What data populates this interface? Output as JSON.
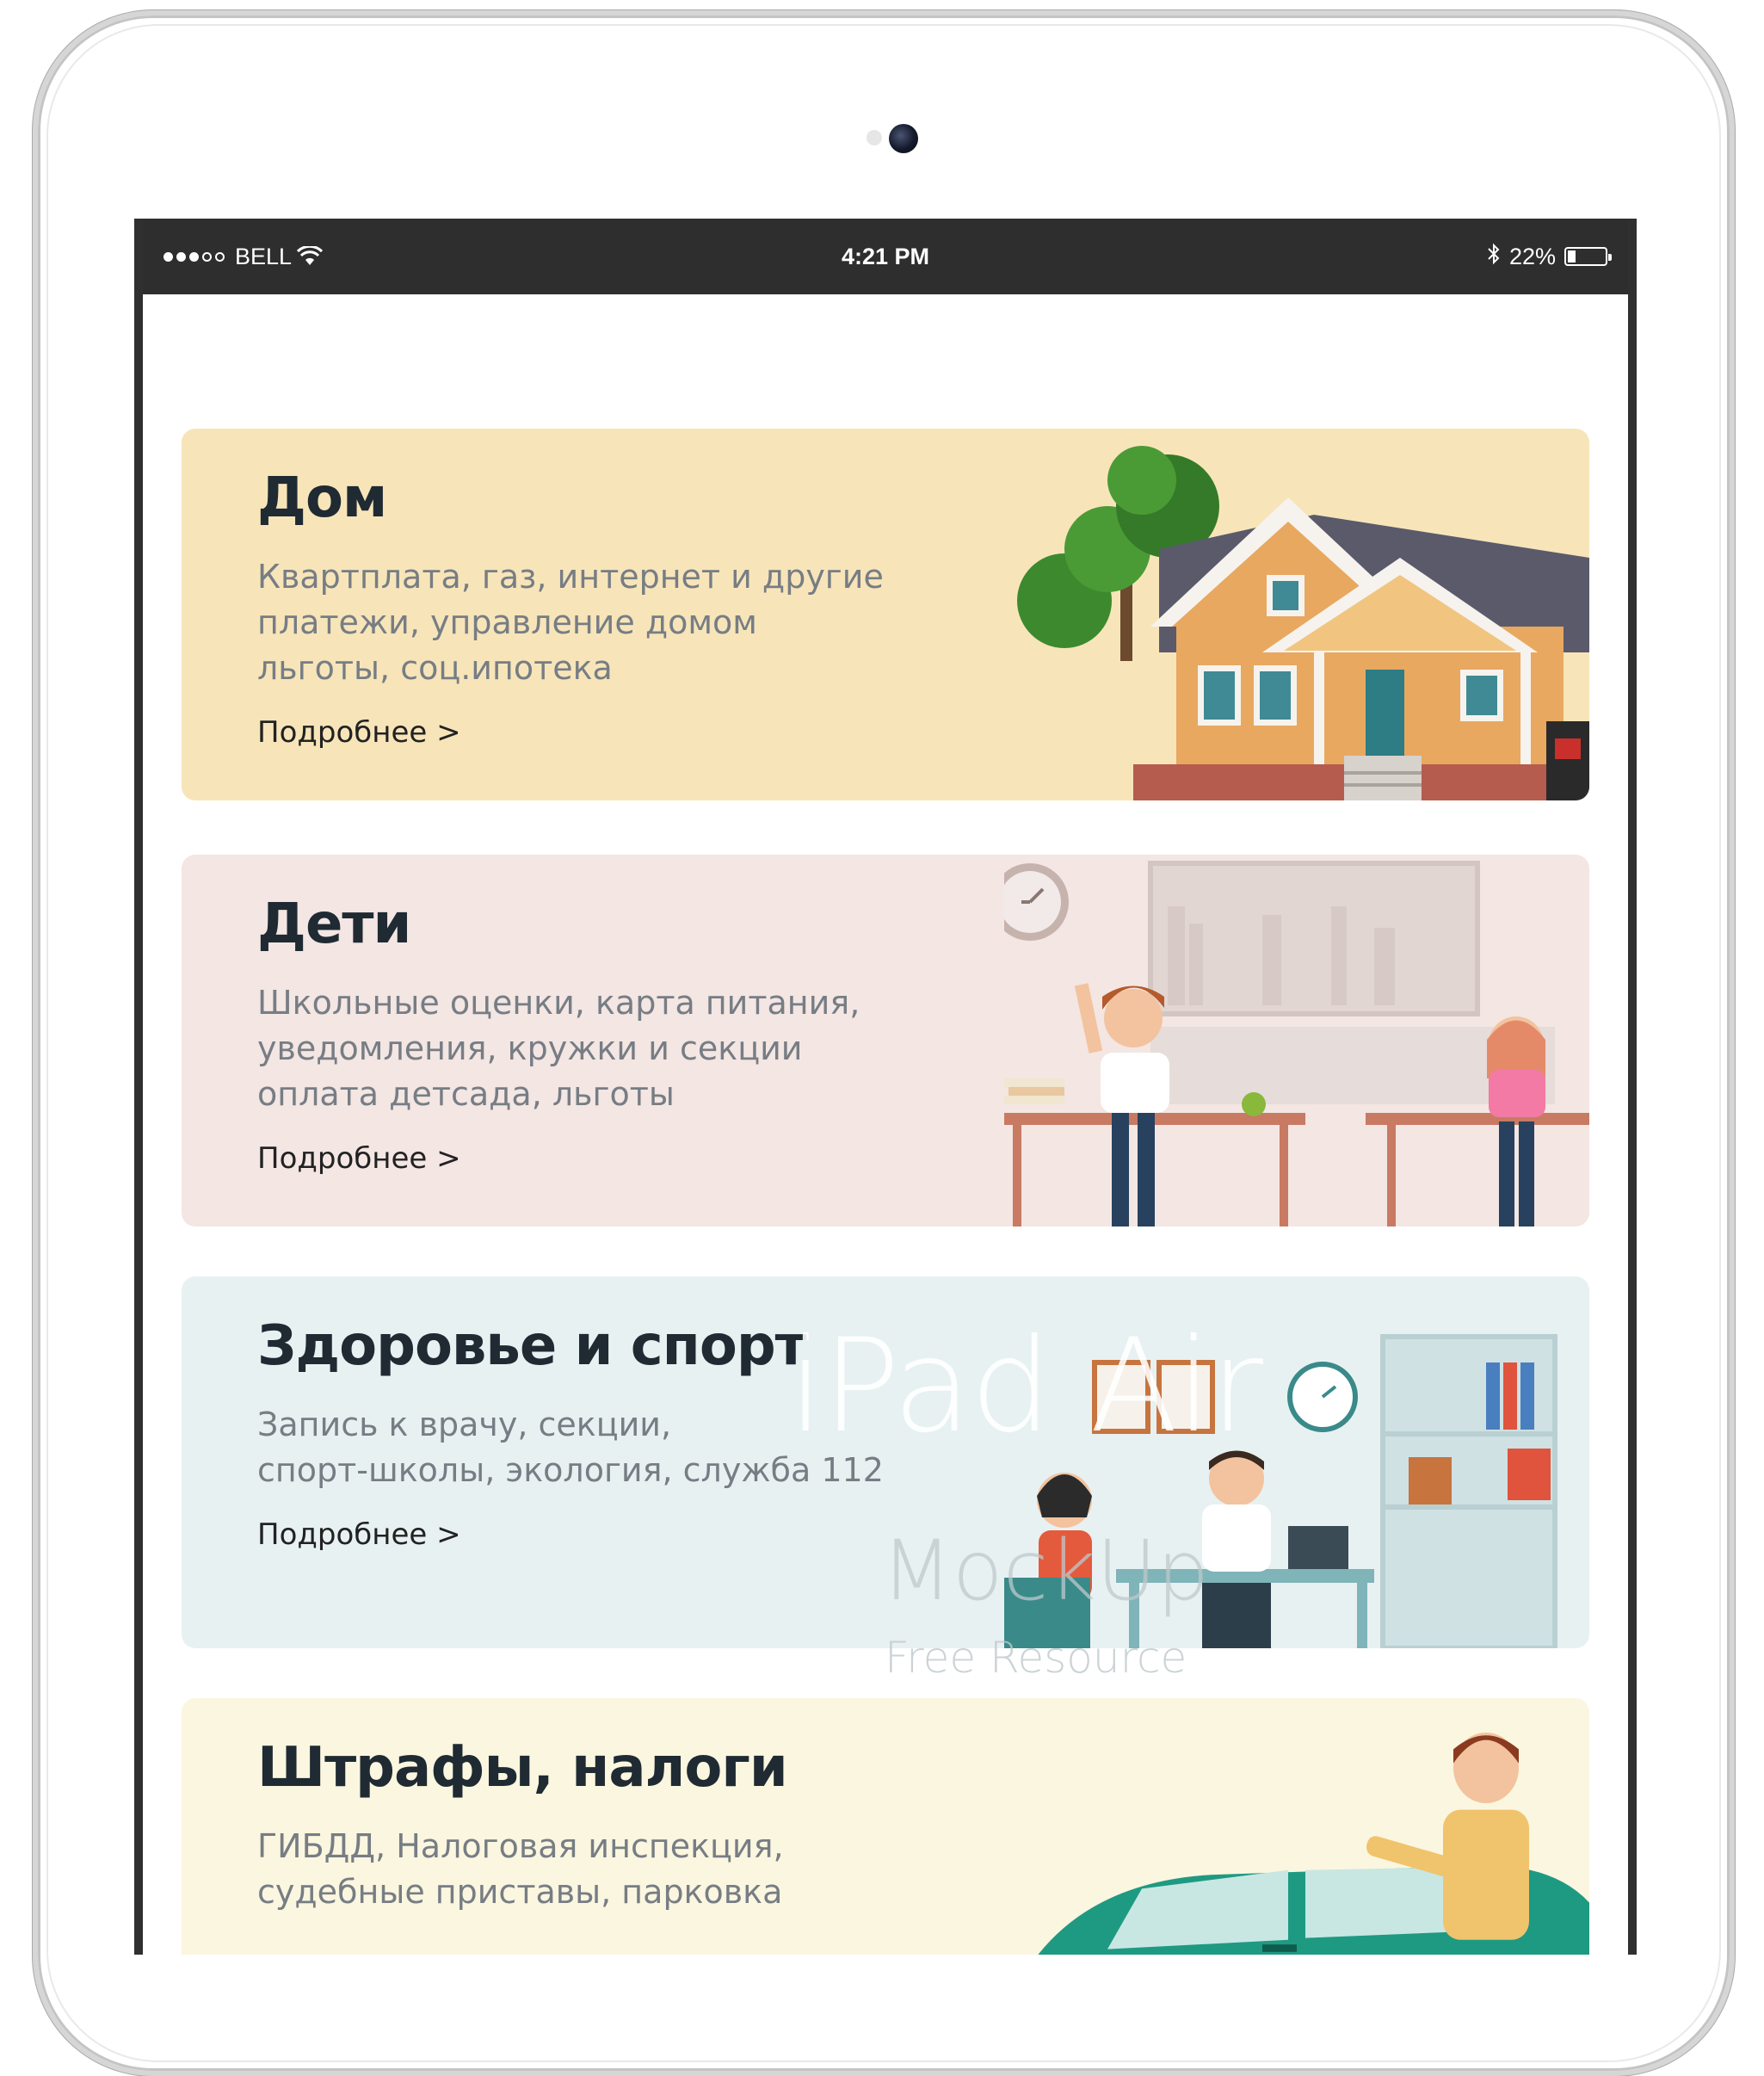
{
  "status_bar": {
    "carrier": "BELL",
    "time": "4:21 PM",
    "battery_percent": "22%",
    "battery_level": 0.22,
    "icons": [
      "signal-dots-icon",
      "wifi-icon",
      "bluetooth-icon",
      "battery-icon"
    ]
  },
  "cards": [
    {
      "title": "Дом",
      "desc": [
        "Квартплата, газ, интернет и другие",
        "платежи, управление домом",
        "льготы, соц.ипотека"
      ],
      "more": "Подробнее >",
      "background": "#f7e5b9",
      "illustration": "house-illustration"
    },
    {
      "title": "Дети",
      "desc": [
        "Школьные оценки, карта питания,",
        "уведомления, кружки и секции",
        "оплата детсада, льготы"
      ],
      "more": "Подробнее >",
      "background": "#f3e6e3",
      "illustration": "classroom-illustration"
    },
    {
      "title": "Здоровье и спорт",
      "desc": [
        "Запись к врачу, секции,",
        "спорт-школы, экология, служба 112"
      ],
      "more": "Подробнее >",
      "background": "#e8f1f2",
      "illustration": "doctor-office-illustration"
    },
    {
      "title": "Штрафы, налоги",
      "desc": [
        "ГИБДД, Налоговая инспекция,",
        "судебные приставы, парковка"
      ],
      "more": "",
      "background": "#fbf6df",
      "illustration": "car-illustration"
    }
  ],
  "watermark": {
    "line1": "iPad Air",
    "line2": "MockUp",
    "line3": "Free Resource"
  },
  "colors": {
    "title": "#1f2a33",
    "description": "#777d84",
    "status_bar": "#2e2e2e"
  }
}
